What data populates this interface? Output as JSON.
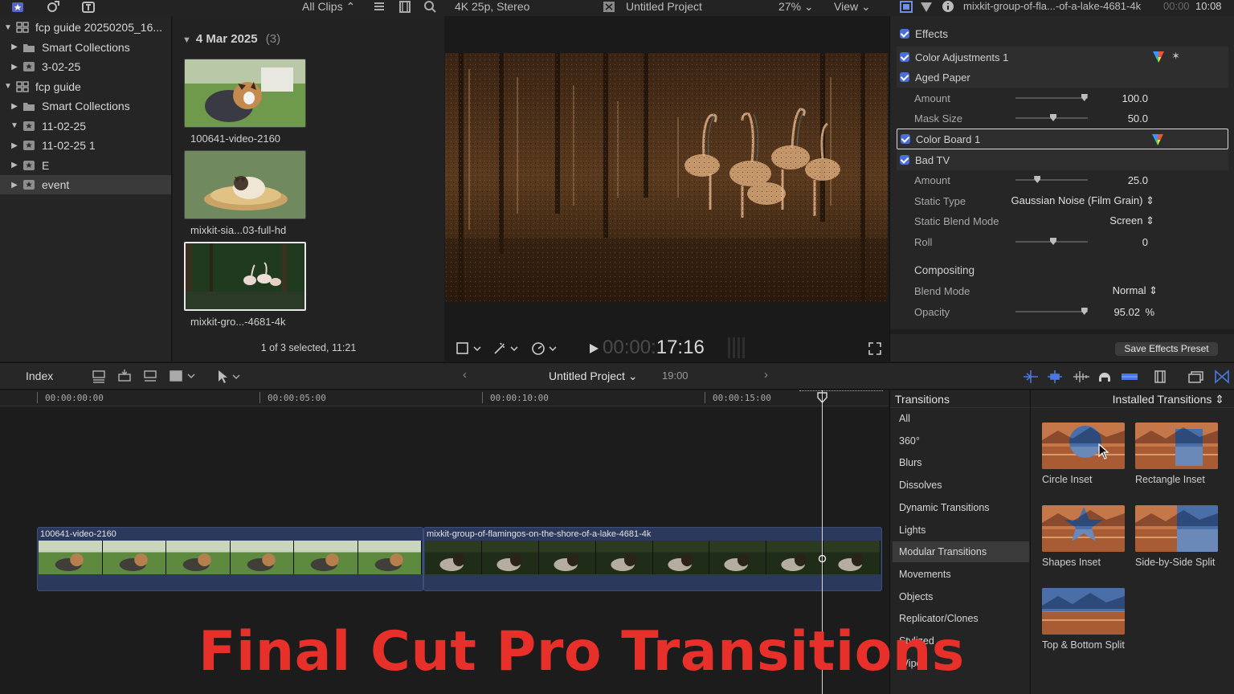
{
  "topbar": {
    "clips_filter": "All Clips",
    "format": "4K 25p, Stereo",
    "project_title": "Untitled Project",
    "zoom": "27%",
    "view_menu": "View",
    "inspector_clip": "mixkit-group-of-fla...-of-a-lake-4681-4k",
    "inspector_time_dim": "00:00",
    "inspector_time": "10:08"
  },
  "sidebar": {
    "items": [
      {
        "label": "fcp guide 20250205_16...",
        "tri": "▼",
        "icon": "library-icon",
        "indent": 0
      },
      {
        "label": "Smart Collections",
        "tri": "▶",
        "icon": "folder-icon",
        "indent": 1
      },
      {
        "label": "3-02-25",
        "tri": "▶",
        "icon": "event-icon",
        "indent": 1
      },
      {
        "label": "fcp guide",
        "tri": "▼",
        "icon": "library-icon",
        "indent": 0
      },
      {
        "label": "Smart Collections",
        "tri": "▶",
        "icon": "folder-icon",
        "indent": 1
      },
      {
        "label": "11-02-25",
        "tri": "▼",
        "icon": "event-icon",
        "indent": 1
      },
      {
        "label": "11-02-25 1",
        "tri": "▶",
        "icon": "event-icon",
        "indent": 1
      },
      {
        "label": "E",
        "tri": "▶",
        "icon": "event-icon",
        "indent": 1
      },
      {
        "label": "event",
        "tri": "▶",
        "icon": "event-icon",
        "indent": 1,
        "selected": true
      }
    ]
  },
  "browser": {
    "date_header": "4 Mar 2025",
    "count": "(3)",
    "clips": [
      {
        "name": "100641-video-2160"
      },
      {
        "name": "mixkit-sia...03-full-hd"
      },
      {
        "name": "mixkit-gro...-4681-4k",
        "selected": true
      }
    ],
    "status": "1 of 3 selected, 11:21"
  },
  "viewer": {
    "timecode_dim": "00:00:",
    "timecode": "17:16"
  },
  "inspector": {
    "effects_header": "Effects",
    "rows": [
      {
        "type": "effect",
        "label": "Color Adjustments 1"
      },
      {
        "type": "effect",
        "label": "Aged Paper"
      },
      {
        "type": "param",
        "label": "Amount",
        "value": "100.0",
        "knob": 0.95
      },
      {
        "type": "param",
        "label": "Mask Size",
        "value": "50.0",
        "knob": 0.5
      },
      {
        "type": "effect",
        "label": "Color Board 1",
        "selected": true
      },
      {
        "type": "effect",
        "label": "Bad TV"
      },
      {
        "type": "param",
        "label": "Amount",
        "value": "25.0",
        "knob": 0.27
      },
      {
        "type": "popup",
        "label": "Static Type",
        "value": "Gaussian Noise (Film Grain)"
      },
      {
        "type": "popup",
        "label": "Static Blend Mode",
        "value": "Screen"
      },
      {
        "type": "param",
        "label": "Roll",
        "value": "0",
        "knob": 0.5
      }
    ],
    "compositing_header": "Compositing",
    "blend_mode_label": "Blend Mode",
    "blend_mode_value": "Normal",
    "opacity_label": "Opacity",
    "opacity_value": "95.02",
    "opacity_unit": "%",
    "opacity_knob": 0.9502,
    "save_preset": "Save Effects Preset"
  },
  "timeline_toolbar": {
    "index": "Index",
    "project": "Untitled Project",
    "duration": "19:00"
  },
  "timeline": {
    "ticks": [
      "00:00:00:00",
      "00:00:05:00",
      "00:00:10:00",
      "00:00:15:00"
    ],
    "clips": [
      {
        "name": "100641-video-2160"
      },
      {
        "name": "mixkit-group-of-flamingos-on-the-shore-of-a-lake-4681-4k"
      }
    ]
  },
  "transitions": {
    "header": "Transitions",
    "source": "Installed Transitions",
    "categories": [
      "All",
      "360°",
      "Blurs",
      "Dissolves",
      "Dynamic Transitions",
      "Lights",
      "Modular Transitions",
      "Movements",
      "Objects",
      "Replicator/Clones",
      "Stylized",
      "Wipes"
    ],
    "selected_category": "Modular Transitions",
    "items": [
      {
        "name": "Circle Inset",
        "style": "circle"
      },
      {
        "name": "Rectangle Inset",
        "style": "rect"
      },
      {
        "name": "Shapes Inset",
        "style": "star"
      },
      {
        "name": "Side-by-Side Split",
        "style": "split"
      },
      {
        "name": "Top & Bottom Split",
        "style": "tb"
      }
    ]
  },
  "overlay_title": "Final Cut Pro Transitions",
  "colors": {
    "accent": "#4a6fd6",
    "title_red": "#e8302a",
    "clip_blue": "#2b3a5c"
  }
}
